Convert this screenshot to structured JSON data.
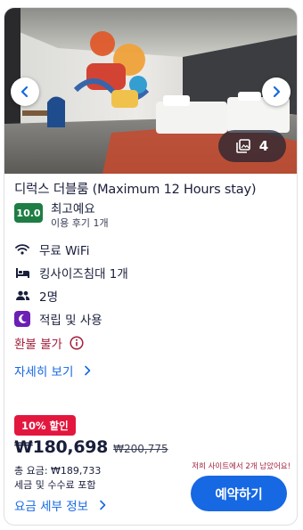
{
  "gallery": {
    "count": "4",
    "prev_icon": "chevron-left-icon",
    "next_icon": "chevron-right-icon",
    "gallery_icon": "images-icon"
  },
  "room": {
    "title": "디럭스 더블룸 (Maximum 12 Hours stay)",
    "rating_score": "10.0",
    "rating_label": "최고예요",
    "rating_reviews": "이용 후기 1개"
  },
  "amenities": [
    {
      "icon": "wifi-icon",
      "label": "무료 WiFi"
    },
    {
      "icon": "bed-icon",
      "label": "킹사이즈침대 1개"
    },
    {
      "icon": "people-icon",
      "label": "2명"
    },
    {
      "icon": "points-moon-icon",
      "label": "적립 및 사용"
    }
  ],
  "refund": {
    "label": "환불 불가",
    "icon": "info-icon"
  },
  "details_link": "자세히 보기",
  "pricing": {
    "discount_badge": "10% 할인",
    "price": "₩180,698",
    "original_price": "₩200,775",
    "total": "총 요금: ₩189,733",
    "taxes": "세금 및 수수료 포함",
    "rooms_left": "저희 사이트에서 2개 남았어요!",
    "fee_details_link": "요금 세부 정보"
  },
  "reserve_button": "예약하기",
  "colors": {
    "accent": "#1668e3",
    "rating": "#1e7d44",
    "discount": "#e3173e",
    "alert": "#a3213c",
    "points": "#6b1fb4"
  }
}
